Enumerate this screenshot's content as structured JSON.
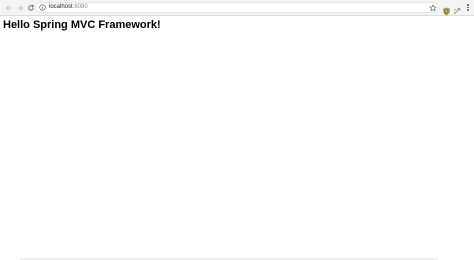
{
  "browser": {
    "address_bar": {
      "host": "localhost",
      "port": ":8080"
    },
    "icons": {
      "back": "back-arrow-icon",
      "forward": "forward-arrow-icon",
      "reload": "reload-icon",
      "info": "info-icon",
      "bookmark": "star-icon",
      "extension_1": "extension-icon",
      "extension_2": "extension-icon",
      "menu": "more-vert-icon"
    },
    "colors": {
      "toolbar_bg": "#f4f4f4",
      "omnibox_bg": "#ffffff",
      "icon_gray": "#5f6368",
      "port_gray": "#8a8a8a"
    }
  },
  "page": {
    "heading": "Hello Spring MVC Framework!"
  }
}
